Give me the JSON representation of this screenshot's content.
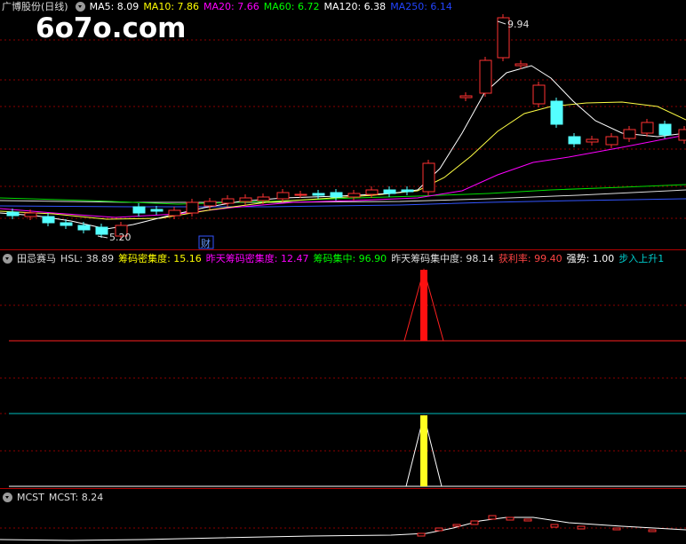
{
  "watermark": "6o7o.com",
  "main": {
    "title": "广博股份(日线)",
    "ma": [
      {
        "label": "MA5: 8.09",
        "color": "#ffffff"
      },
      {
        "label": "MA10: 7.86",
        "color": "#ffff00"
      },
      {
        "label": "MA20: 7.66",
        "color": "#ff00ff"
      },
      {
        "label": "MA60: 6.72",
        "color": "#00ff00"
      },
      {
        "label": "MA120: 6.38",
        "color": "#ffffff"
      },
      {
        "label": "MA250: 6.14",
        "color": "#2244ff"
      }
    ],
    "high_label": "9.94",
    "low_label": "5.20",
    "marker": "财"
  },
  "indicator1": {
    "name": "田忌赛马",
    "items": [
      {
        "label": "HSL: 38.89",
        "color": "#dddddd"
      },
      {
        "label": "筹码密集度: 15.16",
        "color": "#ffff00"
      },
      {
        "label": "昨天筹码密集度: 12.47",
        "color": "#ff00ff"
      },
      {
        "label": "筹码集中: 96.90",
        "color": "#00ff00"
      },
      {
        "label": "昨天筹码集中度: 98.14",
        "color": "#dddddd"
      },
      {
        "label": "获利率: 99.40",
        "color": "#ff4444"
      },
      {
        "label": "强势: 1.00",
        "color": "#ffffff"
      },
      {
        "label": "步入上升1",
        "color": "#00cccc"
      }
    ]
  },
  "indicator2": {
    "name": "MCST",
    "value": "MCST: 8.24"
  },
  "colors": {
    "up": "#ff3232",
    "down": "#54ffff",
    "grid": "#8b0000"
  }
}
